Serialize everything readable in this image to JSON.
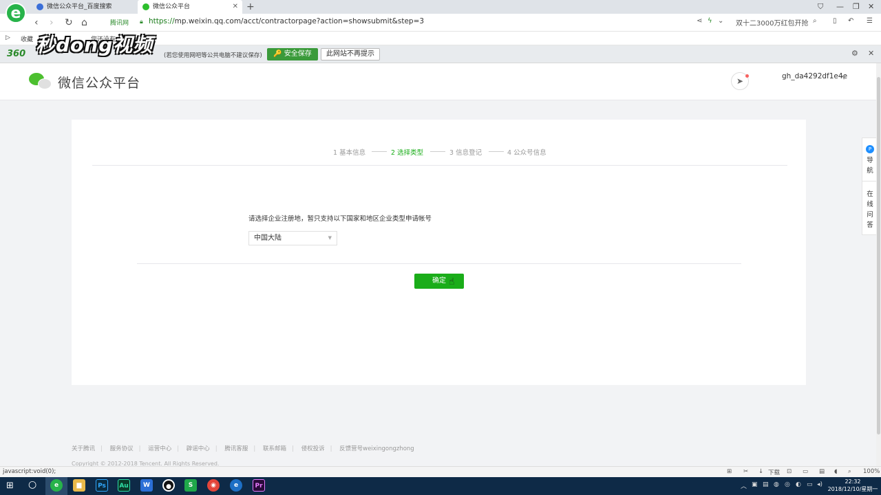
{
  "browser": {
    "tabs": [
      {
        "label": "微信公众平台_百度搜索",
        "active": false
      },
      {
        "label": "微信公众平台",
        "active": true
      }
    ],
    "new_tab": "+",
    "security_tag": "腾讯网",
    "url_protocol": "https://",
    "url_rest": "mp.weixin.qq.com/acct/contractorpage?action=showsubmit&step=3",
    "promo_text": "双十二3000万红包开抢",
    "bookmark_fav": "收藏",
    "bookmark_other": "您还没有",
    "security_bar": {
      "brand": "360",
      "message": "(若您使用网吧等公共电脑不建议保存)",
      "save_label": "🔑 安全保存",
      "dismiss_label": "此网站不再提示"
    },
    "watermark_text": "秒dong视频",
    "status_url": "javascript:void(0);",
    "status_download": "下载",
    "zoom": "100%"
  },
  "site": {
    "title": "微信公众平台",
    "account": "gh_da4292df1e4e"
  },
  "steps": [
    {
      "label": "1 基本信息",
      "current": false
    },
    {
      "label": "2 选择类型",
      "current": true
    },
    {
      "label": "3 信息登记",
      "current": false
    },
    {
      "label": "4 公众号信息",
      "current": false
    }
  ],
  "form": {
    "instruction": "请选择企业注册地，暂只支持以下国家和地区企业类型申请帐号",
    "region_value": "中国大陆",
    "confirm_label": "确定"
  },
  "side_float": {
    "nav_label": "导航",
    "help_label": "在线问答",
    "nav_badge": "P"
  },
  "footer": {
    "links": [
      "关于腾讯",
      "服务协议",
      "运营中心",
      "辟谣中心",
      "腾讯客服",
      "联系邮箱",
      "侵权投诉",
      "反馈营号weixingongzhong"
    ],
    "copyright": "Copyright © 2012-2018 Tencent. All Rights Reserved."
  },
  "taskbar": {
    "time": "22:32",
    "date": "2018/12/10/星期一"
  },
  "colors": {
    "brand_green": "#1aad19",
    "taskbar": "#0e2a47"
  }
}
